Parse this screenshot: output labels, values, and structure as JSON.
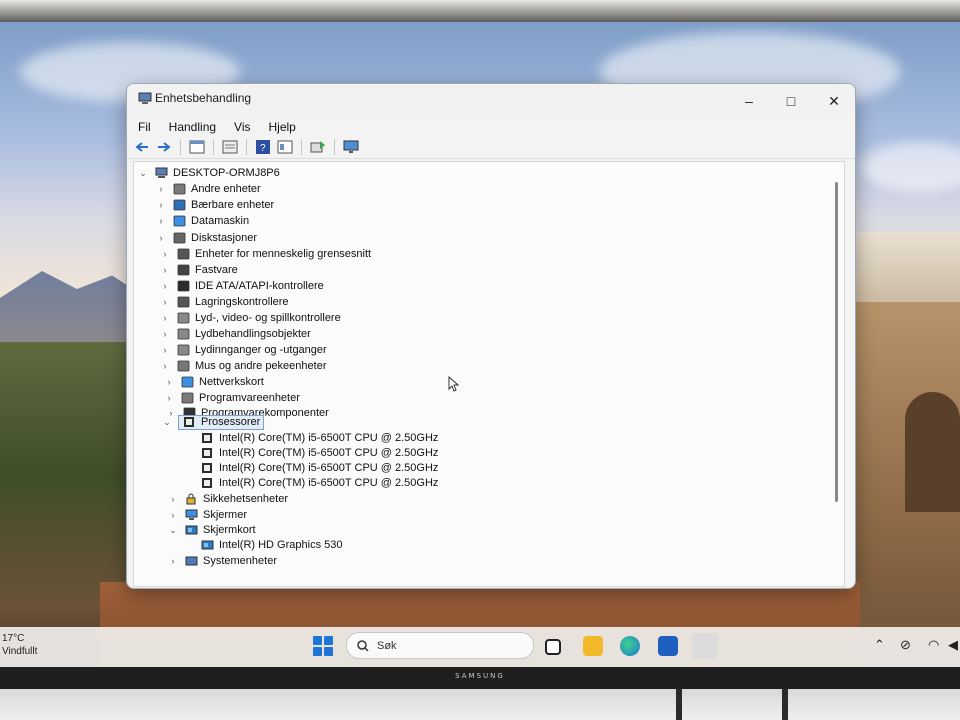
{
  "window": {
    "title": "Enhetsbehandling",
    "minimize_icon": "–",
    "maximize_icon": "□",
    "close_icon": "✕"
  },
  "menu": [
    "Fil",
    "Handling",
    "Vis",
    "Hjelp"
  ],
  "toolbar_icons": [
    "back-icon",
    "forward-icon",
    "properties-icon",
    "toggle-view-icon",
    "help-icon",
    "details-icon",
    "update-driver-icon",
    "monitor-scan-icon"
  ],
  "tree": {
    "root": "DESKTOP-ORMJ8P6",
    "categories": [
      {
        "label": "Andre enheter",
        "icon": "unknown-device-icon"
      },
      {
        "label": "Bærbare enheter",
        "icon": "portable-device-icon"
      },
      {
        "label": "Datamaskin",
        "icon": "computer-icon"
      },
      {
        "label": "Diskstasjoner",
        "icon": "disk-icon"
      },
      {
        "label": "Enheter for menneskelig grensesnitt",
        "icon": "hid-icon"
      },
      {
        "label": "Fastvare",
        "icon": "firmware-icon"
      },
      {
        "label": "IDE ATA/ATAPI-kontrollere",
        "icon": "ide-icon"
      },
      {
        "label": "Lagringskontrollere",
        "icon": "storage-icon"
      },
      {
        "label": "Lyd-, video- og spillkontrollere",
        "icon": "audio-icon"
      },
      {
        "label": "Lydbehandlingsobjekter",
        "icon": "audio-processing-icon"
      },
      {
        "label": "Lydinnganger og -utganger",
        "icon": "audio-io-icon"
      },
      {
        "label": "Mus og andre pekeenheter",
        "icon": "mouse-icon"
      },
      {
        "label": "Nettverkskort",
        "icon": "network-icon"
      },
      {
        "label": "Programvareenheter",
        "icon": "software-device-icon"
      },
      {
        "label": "Programvarekomponenter",
        "icon": "software-component-icon"
      }
    ],
    "processors": {
      "label": "Prosessorer",
      "children": [
        "Intel(R) Core(TM) i5-6500T CPU @ 2.50GHz",
        "Intel(R) Core(TM) i5-6500T CPU @ 2.50GHz",
        "Intel(R) Core(TM) i5-6500T CPU @ 2.50GHz",
        "Intel(R) Core(TM) i5-6500T CPU @ 2.50GHz"
      ]
    },
    "after": [
      {
        "label": "Sikkehetsenheter",
        "icon": "security-icon"
      },
      {
        "label": "Skjermer",
        "icon": "monitor-icon"
      }
    ],
    "display_adapters": {
      "label": "Skjermkort",
      "children": [
        "Intel(R) HD Graphics 530"
      ]
    },
    "partial": "Systemenheter"
  },
  "taskbar": {
    "temperature": "17°C",
    "weather": "Vindfullt",
    "search_placeholder": "Søk"
  },
  "monitor_brand": "SAMSUNG",
  "colors": {
    "accent": "#1f74d8",
    "selection": "#e1ecf8"
  }
}
